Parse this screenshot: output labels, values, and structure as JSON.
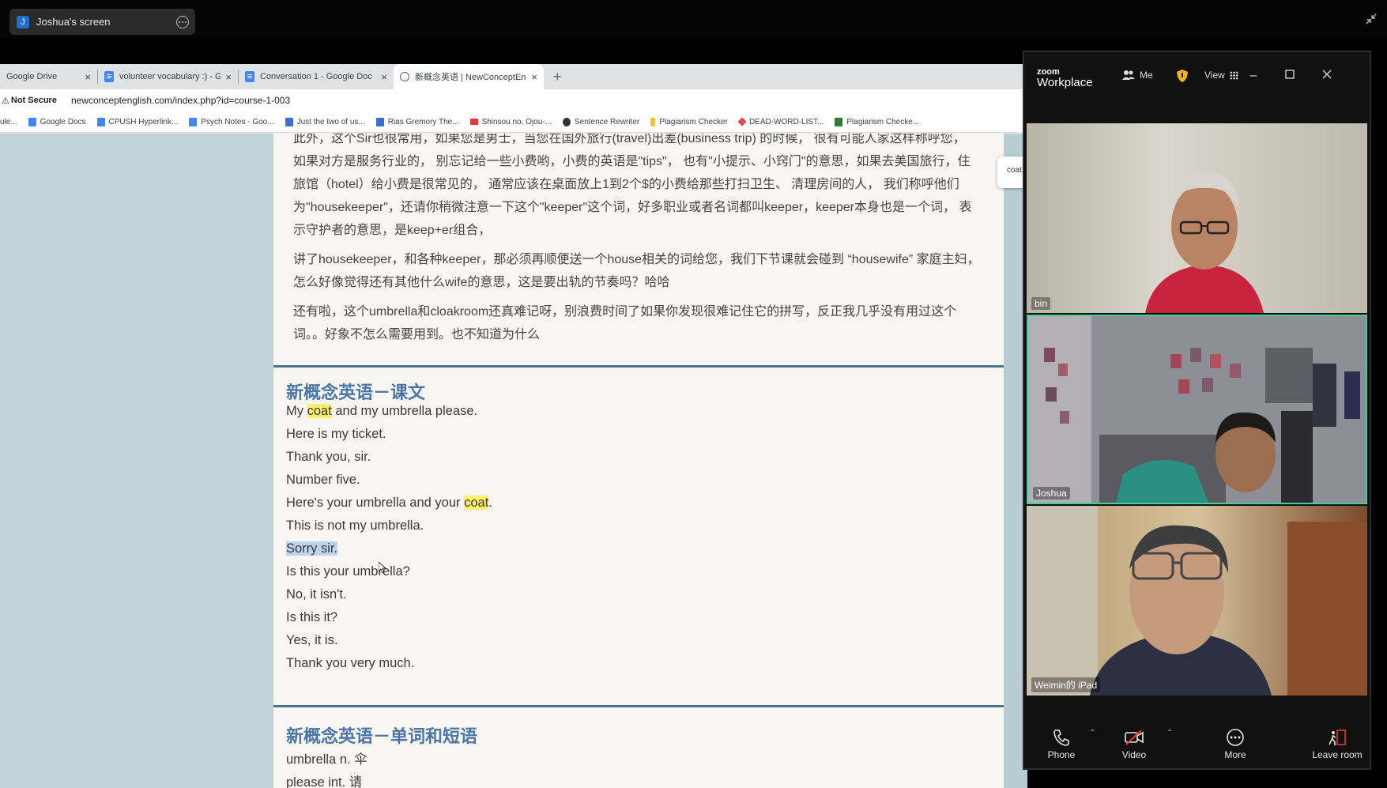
{
  "share_bar": {
    "avatar_letter": "J",
    "screen_name": "Joshua's screen"
  },
  "browser": {
    "tabs": [
      {
        "label": "Google Drive",
        "icon": "drive-icon"
      },
      {
        "label": "volunteer vocabulary :) - Goo",
        "icon": "docs-icon"
      },
      {
        "label": "Conversation 1 - Google Doc",
        "icon": "docs-icon"
      },
      {
        "label": "新概念英语 | NewConceptEng",
        "icon": "globe-icon",
        "active": true
      }
    ],
    "new_tab_label": "+",
    "security_label": "Not Secure",
    "url": "newconceptenglish.com/index.php?id=course-1-003",
    "bookmarks": [
      {
        "label": "ule...",
        "color": "#555"
      },
      {
        "label": "Google Docs",
        "color": "#4285f4"
      },
      {
        "label": "CPUSH Hyperlink...",
        "color": "#4285f4"
      },
      {
        "label": "Psych Notes - Goo...",
        "color": "#4285f4"
      },
      {
        "label": "Just the two of us...",
        "color": "#3a6fd8"
      },
      {
        "label": "Rias Gremory The...",
        "color": "#3a6fd8"
      },
      {
        "label": "Shinsou no, Ojou-...",
        "color": "#e53935"
      },
      {
        "label": "Sentence Rewriter",
        "color": "#333"
      },
      {
        "label": "Plagiarism Checker",
        "color": "#f5c23b"
      },
      {
        "label": "DEAD-WORD-LIST...",
        "color": "#d9534f"
      },
      {
        "label": "Plagiarism Checke...",
        "color": "#2e7d32"
      }
    ],
    "find_popup_text": "coat"
  },
  "article": {
    "paragraphs": [
      "此外，这个Sir也很常用，如果您是男士，当您在国外旅行(travel)出差(business trip) 的时候， 很有可能人家这样称呼您， 如果对方是服务行业的， 别忘记给一些小费哟，小费的英语是\"tips\"， 也有\"小提示、小窍门\"的意思，如果去美国旅行，住旅馆（hotel）给小费是很常见的， 通常应该在桌面放上1到2个$的小费给那些打扫卫生、 清理房间的人， 我们称呼他们为\"housekeeper\"，还请你稍微注意一下这个\"keeper\"这个词，好多职业或者名词都叫keeper，keeper本身也是一个词， 表示守护者的意思，是keep+er组合，",
      "讲了housekeeper，和各种keeper，那必须再顺便送一个house相关的词给您，我们下节课就会碰到 “housewife” 家庭主妇，怎么好像觉得还有其他什么wife的意思，这是要出轨的节奏吗？哈哈",
      "还有啦，这个umbrella和cloakroom还真难记呀，别浪费时间了如果你发现很难记住它的拼写，反正我几乎没有用过这个词。。好象不怎么需要用到。也不知道为什么"
    ],
    "lesson_title": "新概念英语－课文",
    "lesson_lines": [
      {
        "pre": "My ",
        "hl": "coat",
        "post": " and my umbrella please."
      },
      {
        "pre": "Here is my ticket.",
        "hl": "",
        "post": ""
      },
      {
        "pre": "Thank you, sir.",
        "hl": "",
        "post": ""
      },
      {
        "pre": "Number five.",
        "hl": "",
        "post": ""
      },
      {
        "pre": "Here's your umbrella and your ",
        "hl": "coat",
        "post": "."
      },
      {
        "pre": "This is not my umbrella.",
        "hl": "",
        "post": ""
      },
      {
        "pre": "",
        "sel": "Sorry sir.",
        "post": ""
      },
      {
        "pre": "Is this your umbrella?",
        "hl": "",
        "post": ""
      },
      {
        "pre": "No, it isn't.",
        "hl": "",
        "post": ""
      },
      {
        "pre": "Is this it?",
        "hl": "",
        "post": ""
      },
      {
        "pre": "Yes, it is.",
        "hl": "",
        "post": ""
      },
      {
        "pre": "Thank you very much.",
        "hl": "",
        "post": ""
      }
    ],
    "vocab_title": "新概念英语－单词和短语",
    "vocab_lines": [
      "umbrella n. 伞",
      "please int. 请"
    ]
  },
  "zoom": {
    "logo_top": "zoom",
    "logo_bottom": "Workplace",
    "people_label": "Me",
    "view_label": "View",
    "participants": [
      {
        "name": "bin"
      },
      {
        "name": "Joshua"
      },
      {
        "name": "Weimin的 iPad"
      }
    ],
    "toolbar": {
      "phone": "Phone",
      "video": "Video",
      "more": "More",
      "leave": "Leave room"
    }
  },
  "colors": {
    "page_bg": "#bfd3d9",
    "section_title": "#4a76a8",
    "highlight": "#fff06a",
    "active_speaker_border": "#3fd09b"
  }
}
